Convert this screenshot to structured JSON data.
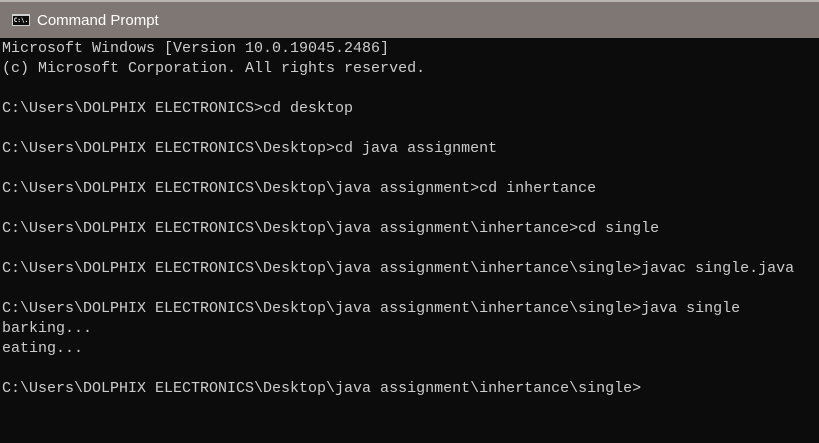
{
  "window": {
    "title": "Command Prompt",
    "icon": "cmd-icon",
    "icon_text": "C:\\."
  },
  "console": {
    "lines": [
      "Microsoft Windows [Version 10.0.19045.2486]",
      "(c) Microsoft Corporation. All rights reserved.",
      "",
      "C:\\Users\\DOLPHIX ELECTRONICS>cd desktop",
      "",
      "C:\\Users\\DOLPHIX ELECTRONICS\\Desktop>cd java assignment",
      "",
      "C:\\Users\\DOLPHIX ELECTRONICS\\Desktop\\java assignment>cd inhertance",
      "",
      "C:\\Users\\DOLPHIX ELECTRONICS\\Desktop\\java assignment\\inhertance>cd single",
      "",
      "C:\\Users\\DOLPHIX ELECTRONICS\\Desktop\\java assignment\\inhertance\\single>javac single.java",
      "",
      "C:\\Users\\DOLPHIX ELECTRONICS\\Desktop\\java assignment\\inhertance\\single>java single",
      "barking...",
      "eating...",
      "",
      "C:\\Users\\DOLPHIX ELECTRONICS\\Desktop\\java assignment\\inhertance\\single>"
    ]
  },
  "colors": {
    "titlebar": "#7f7774",
    "background": "#0c0c0c",
    "text": "#cccccc"
  }
}
